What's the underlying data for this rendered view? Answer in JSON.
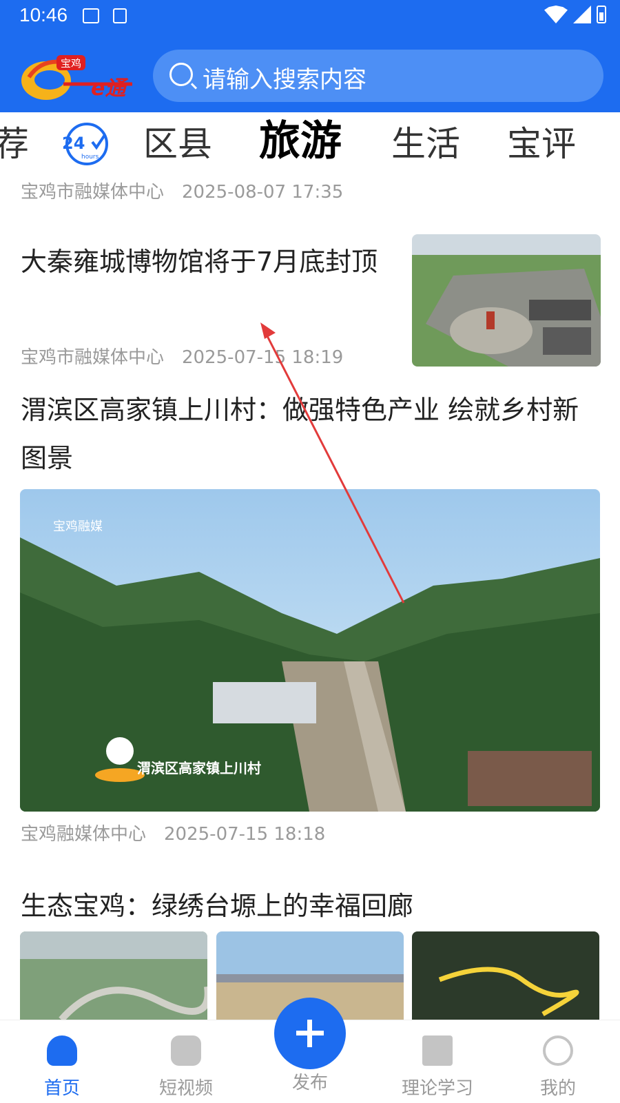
{
  "status_bar": {
    "time": "10:46"
  },
  "header": {
    "logo_text": "宝鸡一e通",
    "search_placeholder": "请输入搜索内容"
  },
  "tabs": [
    {
      "label": "荐",
      "active": false
    },
    {
      "label": "区县",
      "active": false
    },
    {
      "label": "旅游",
      "active": true
    },
    {
      "label": "生活",
      "active": false
    },
    {
      "label": "宝评",
      "active": false
    }
  ],
  "feed": [
    {
      "source": "宝鸡市融媒体中心",
      "time": "2025-08-07 17:35"
    },
    {
      "title": "大秦雍城博物馆将于7月底封顶",
      "source": "宝鸡市融媒体中心",
      "time": "2025-07-15 18:19"
    },
    {
      "title": "渭滨区高家镇上川村：做强特色产业 绘就乡村新图景",
      "image_logo": "宝鸡融媒",
      "image_caption": "渭滨区高家镇上川村",
      "source": "宝鸡融媒体中心",
      "time": "2025-07-15 18:18"
    },
    {
      "title": "生态宝鸡：绿绣台塬上的幸福回廊"
    }
  ],
  "bottom_nav": [
    {
      "label": "首页",
      "icon": "home-icon",
      "active": true
    },
    {
      "label": "短视频",
      "icon": "video-icon",
      "active": false
    },
    {
      "label": "发布",
      "icon": "plus-icon",
      "active": false
    },
    {
      "label": "理论学习",
      "icon": "book-icon",
      "active": false
    },
    {
      "label": "我的",
      "icon": "user-icon",
      "active": false
    }
  ],
  "colors": {
    "brand": "#1d6cf0",
    "meta_text": "#9a9a9a",
    "annotation_arrow": "#e23b3b"
  }
}
